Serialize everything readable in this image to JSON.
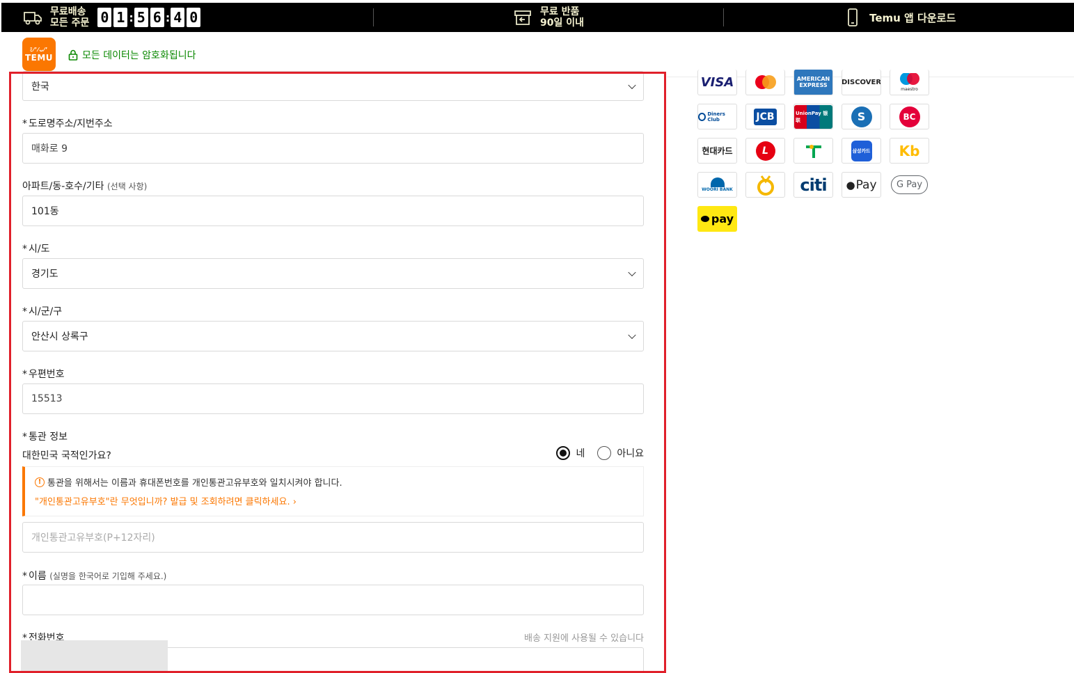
{
  "topbar": {
    "shipping_line1": "무료배송",
    "shipping_line2": "모든 주문",
    "timer": [
      "0",
      "1",
      "5",
      "6",
      "4",
      "0"
    ],
    "returns_line1": "무료 반품",
    "returns_line2": "90일 이내",
    "app_download": "Temu 앱 다운로드"
  },
  "header": {
    "logo_top": "ﾐ⁄ʼ⁄ᴗ⁄ʼ",
    "logo_text": "TEMU",
    "secure_text": "모든 데이터는 암호화됩니다"
  },
  "form": {
    "country_value": "한국",
    "road_address_label": "도로명주소/지번주소",
    "road_address_value": "매화로 9",
    "apt_label": "아파트/동-호수/기타",
    "apt_optional": "(선택 사항)",
    "apt_value": "101동",
    "province_label": "시/도",
    "province_value": "경기도",
    "city_label": "시/군/구",
    "city_value": "안산시 상록구",
    "zip_label": "우편번호",
    "zip_value": "15513",
    "customs_label": "통관 정보",
    "nationality_question": "대한민국 국적인가요?",
    "yes_label": "네",
    "no_label": "아니요",
    "notice_text": "통관을 위해서는 이름과 휴대폰번호를 개인통관고유부호와 일치시켜야 합니다.",
    "notice_link": "\"개인통관고유부호\"란 무엇입니까? 발급 및 조회하려면 클릭하세요.",
    "customs_code_placeholder": "개인통관고유부호(P+12자리)",
    "name_label": "이름",
    "name_hint": "(실명을 한국어로 기입해 주세요.)",
    "name_value": "",
    "phone_label": "전화번호",
    "phone_hint": "배송 지원에 사용될 수 있습니다",
    "required_mark": "*"
  },
  "payments": [
    {
      "name": "VISA",
      "color": "#1a1f71"
    },
    {
      "name": "",
      "color": "#eb001b"
    },
    {
      "name": "AMERICAN EXPRESS",
      "color": "#2e77bc"
    },
    {
      "name": "DISCOVER",
      "color": "#111111"
    },
    {
      "name": "maestro",
      "color": "#0099df"
    },
    {
      "name": "Diners Club",
      "color": "#004a97"
    },
    {
      "name": "JCB",
      "color": "#0b4ea2"
    },
    {
      "name": "UnionPay 银联",
      "color": "#d6001c"
    },
    {
      "name": "S",
      "color": "#1a6fb5"
    },
    {
      "name": "BC",
      "color": "#e4003a"
    },
    {
      "name": "현대카드",
      "color": "#111111"
    },
    {
      "name": "L",
      "color": "#e60012"
    },
    {
      "name": "",
      "color": "#00a651"
    },
    {
      "name": "삼성카드",
      "color": "#1f5fd8"
    },
    {
      "name": "Kb",
      "color": "#ffbc00"
    },
    {
      "name": "WOORI BANK",
      "color": "#0067ac"
    },
    {
      "name": "",
      "color": "#f5b800"
    },
    {
      "name": "citi",
      "color": "#003b70"
    },
    {
      "name": "Pay",
      "color": "#000000"
    },
    {
      "name": "G Pay",
      "color": "#5f6368"
    },
    {
      "name": "pay",
      "color": "#ffe812"
    }
  ]
}
